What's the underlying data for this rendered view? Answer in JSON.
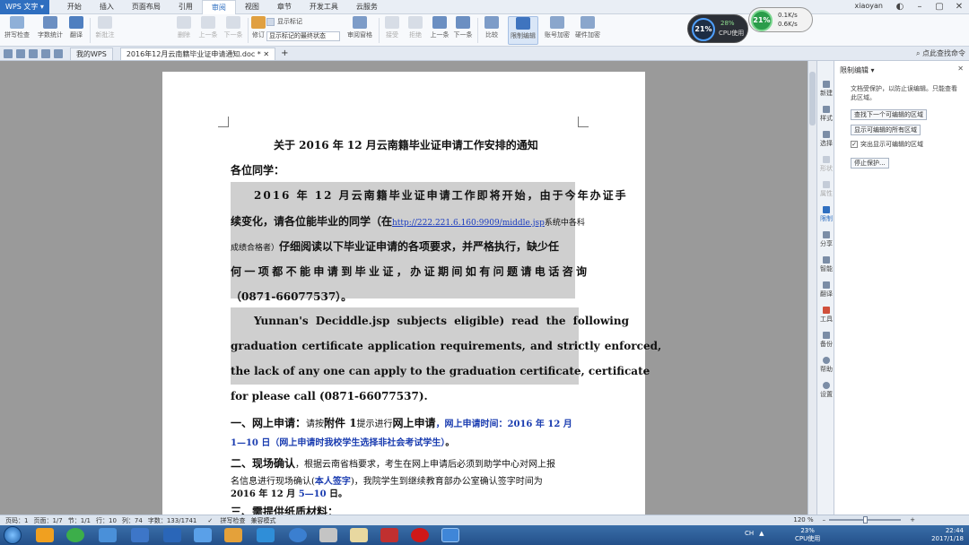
{
  "menubar": {
    "app_label": "WPS 文字",
    "tabs": [
      "开始",
      "插入",
      "页面布局",
      "引用",
      "审阅",
      "视图",
      "章节",
      "开发工具",
      "云服务"
    ],
    "active_tab": "审阅",
    "user": "xiaoyan"
  },
  "ribbon": {
    "buttons": [
      "拼写检查",
      "字数统计",
      "翻译",
      "新批注",
      "删除",
      "上一条",
      "下一条",
      "修订",
      "审阅窗格",
      "接受",
      "拒绝",
      "上一条",
      "下一条",
      "比较",
      "限制编辑",
      "账号加密",
      "硬件加密"
    ],
    "markup_select": "显示标记的最终状态",
    "show_markup": "显示标记"
  },
  "tabbar": {
    "home_tab": "我的WPS",
    "doc_tab": "2016年12月云南籍毕业证申请通知.doc *",
    "find": "点此查找命令"
  },
  "document": {
    "title": "关于 2016 年 12 月云南籍毕业证申请工作安排的通知",
    "greeting": "各位同学：",
    "p1_l1": "2016 年 12 月云南籍毕业证申请工作即将开始，由于今年办证手",
    "p1_l2a": "续变化，请各位能毕业的同学（在",
    "p1_url": "http://222.221.6.160:9909/middle.jsp",
    "p1_l2b": "系统中各科",
    "p1_l3a": "成绩合格者）",
    "p1_l3b": "仔细阅读以下毕业证申请的各项要求，并严格执行，缺少任",
    "p1_l4": "何一项都不能申请到毕业证，办证期间如有问题请电话咨询",
    "p1_l5": "（0871-66077537）。",
    "p2_l1": "Yunnan's  Deciddle.jsp  subjects  eligible)  read  the  following",
    "p2_l2": "graduation certificate application requirements, and strictly enforced,",
    "p2_l3": "the lack of any one can apply to the graduation certificate, certificate",
    "p2_l4": "for please call (0871-66077537).",
    "s1_a": "一、网上申请：",
    "s1_b": "请按",
    "s1_c": "附件 1",
    "s1_d": "提示进行",
    "s1_e": "网上申请",
    "s1_f": "，网上申请时间：2016 年 12 月",
    "s1_l2": "1—10 日（网上申请时我校学生选择非社会考试学生）",
    "s1_l2_end": "。",
    "s2_a": "二、现场确认",
    "s2_b": "，根据云南省档要求，考生在网上申请后必须到助学中心对网上报",
    "s2_l2a": "名信息进行现场确认(",
    "s2_l2b": "本人签字",
    "s2_l2c": ")，我院学生到继续教育部办公室确认签字时间为",
    "s2_l3a": "2016 年 12 月 ",
    "s2_l3b": "5—10",
    "s2_l3c": " 日。",
    "s3": "三、需提供纸质材料："
  },
  "vtoolbar": [
    "新建",
    "样式",
    "选择",
    "形状",
    "属性",
    "限制",
    "分享",
    "智能",
    "翻译",
    "工具",
    "备份",
    "帮助",
    "设置"
  ],
  "pane": {
    "title": "限制编辑 ▾",
    "desc": "文档受保护，以防止误编辑。只能查看此区域。",
    "btn1": "查找下一个可编辑的区域",
    "btn2": "显示可编辑的所有区域",
    "check": "突出显示可编辑的区域",
    "btn3": "停止保护..."
  },
  "statusbar": {
    "page": "页码：1",
    "pages": "页面：1/7",
    "section": "节：1/1",
    "row": "行：10",
    "col": "列：74",
    "words": "字数：133/1741",
    "spell": "拼写检查",
    "mode": "兼容模式",
    "zoom": "120 %"
  },
  "widgets": {
    "cpu_pct": "21%",
    "cpu_sub": "28%",
    "cpu_label": "CPU使用",
    "net_pct": "21%",
    "net_up": "0.1K/s",
    "net_down": "0.6K/s"
  },
  "tray": {
    "ime": "CH",
    "cpu": "23%",
    "cpu_label": "CPU使用",
    "time": "22:44",
    "date": "2017/1/18"
  },
  "colors": {
    "accent": "#2f6fc0",
    "highlight": "#cfcfcf",
    "link": "#1a3cc0",
    "blue_text": "#1a3cb0"
  }
}
